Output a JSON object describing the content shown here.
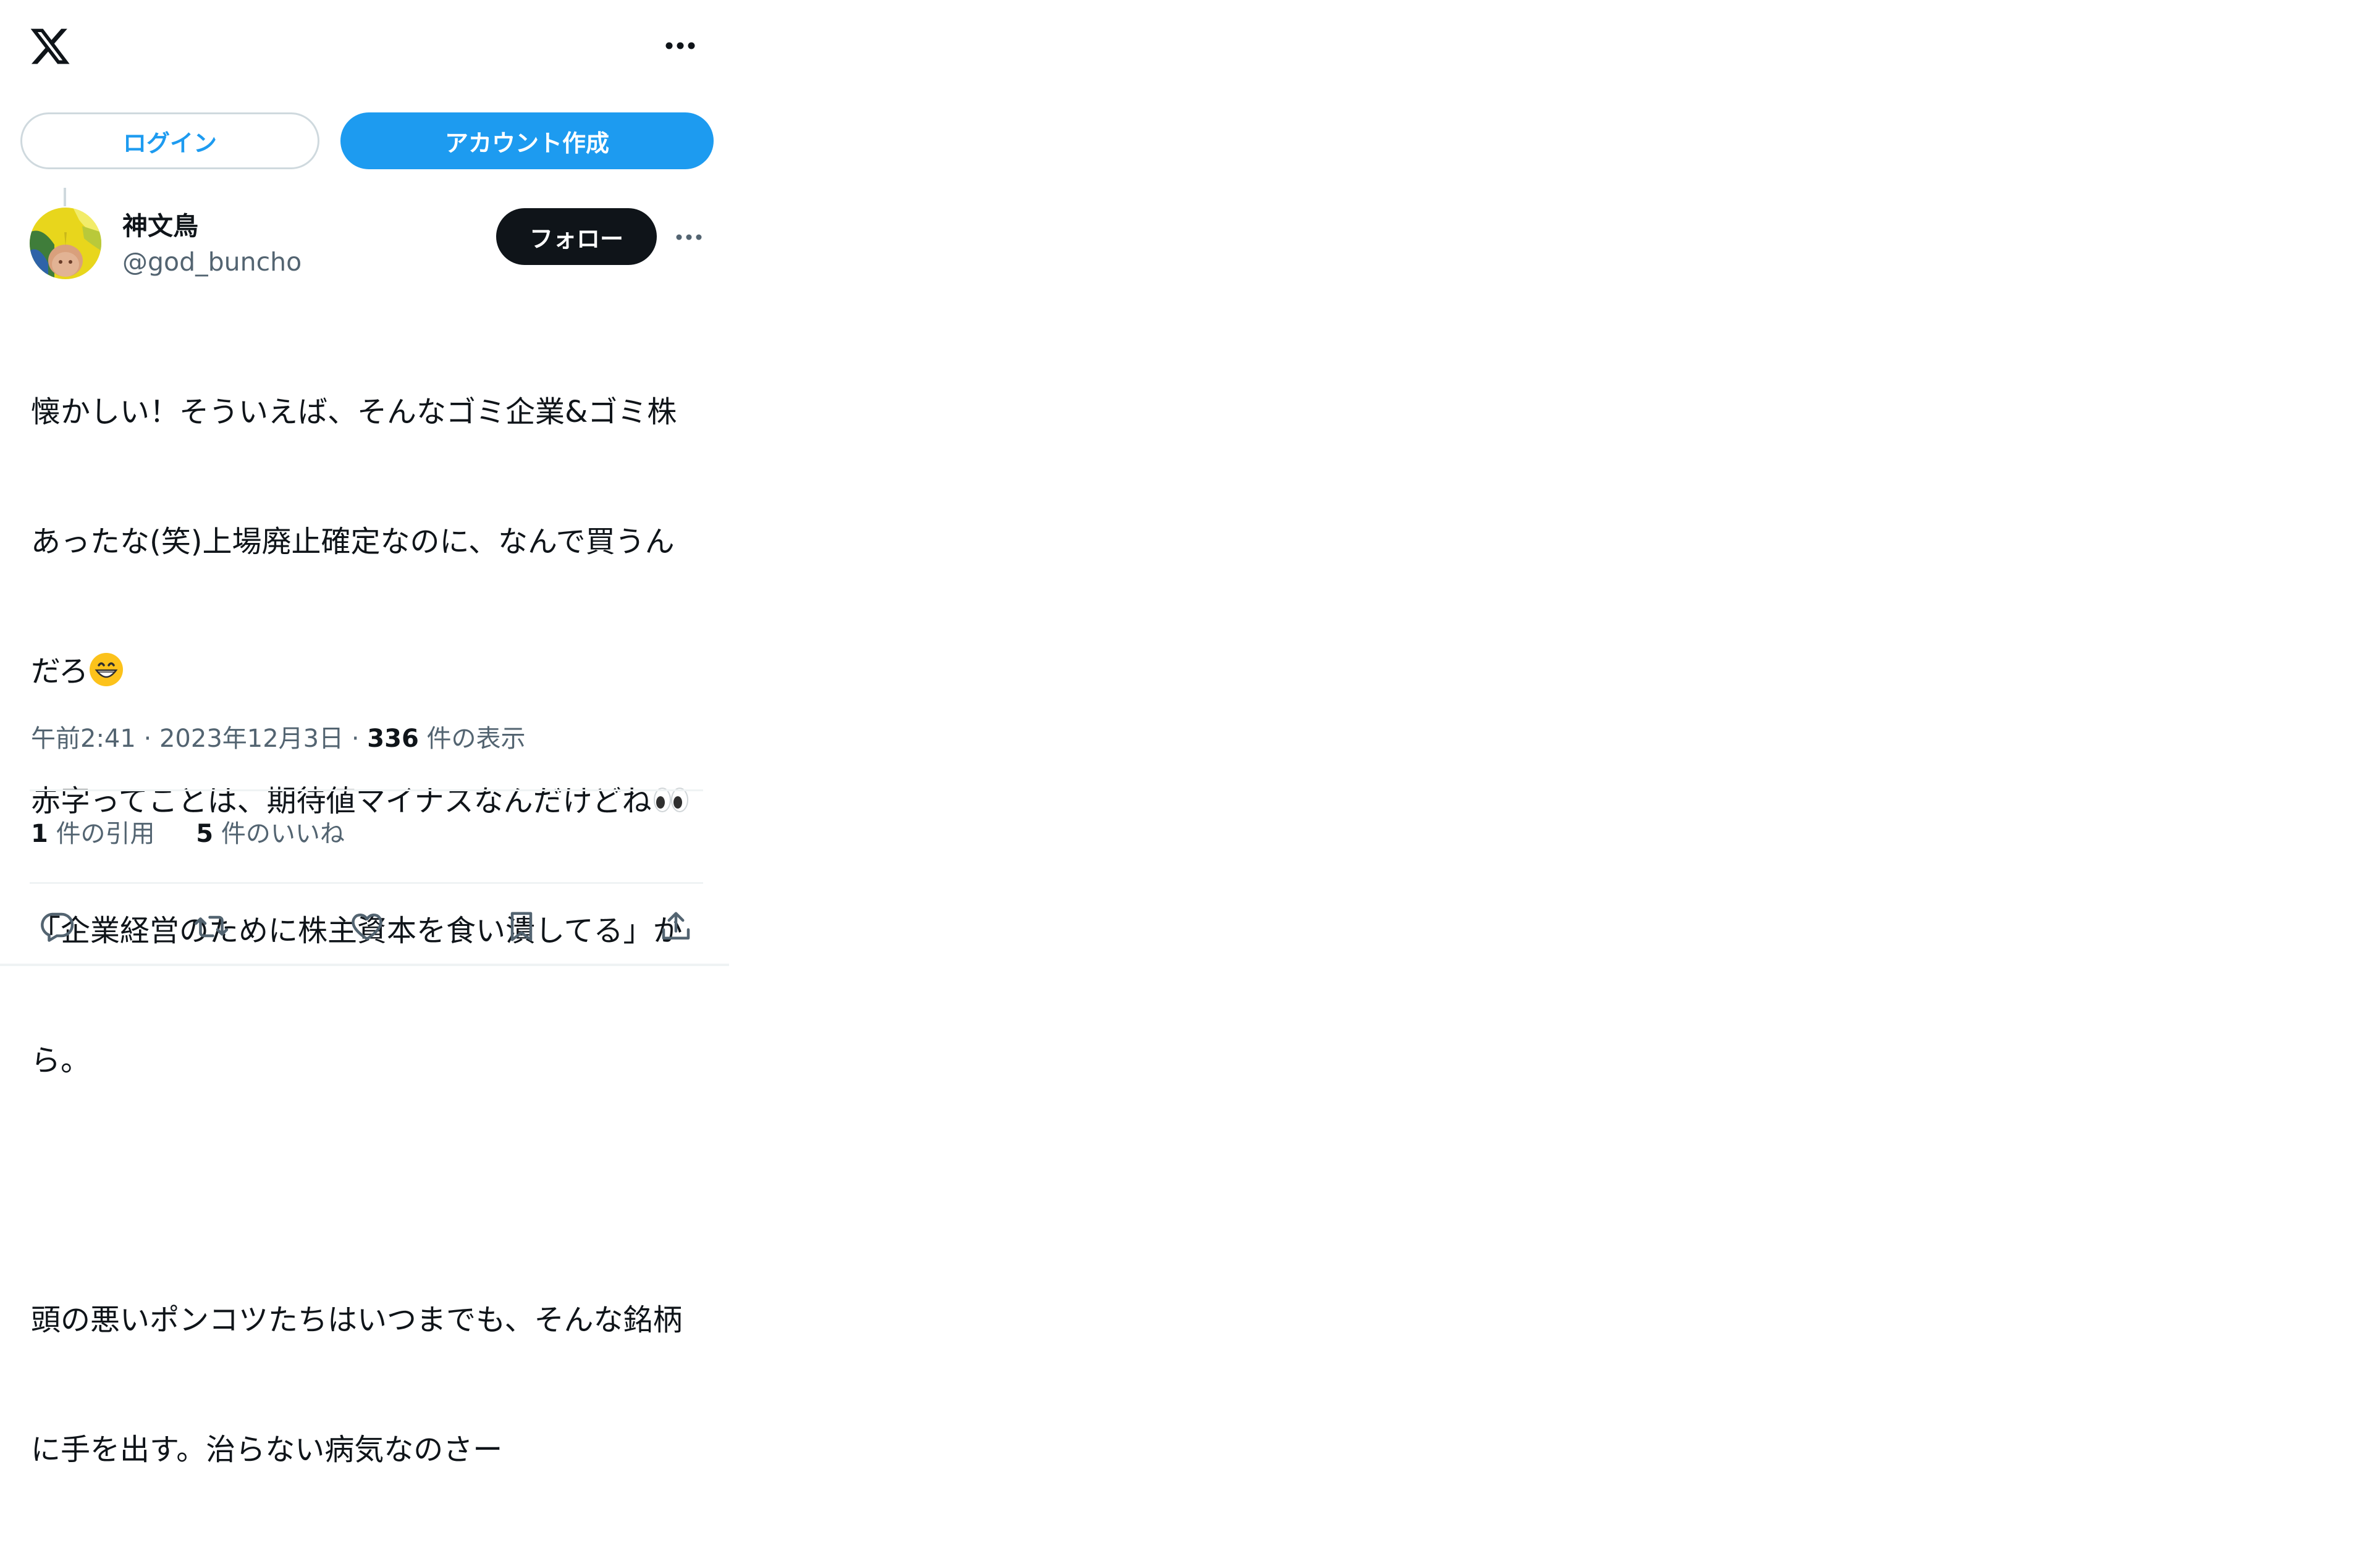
{
  "header": {
    "logo_icon": "x-logo-icon",
    "more_icon": "more-horizontal-icon"
  },
  "auth": {
    "login_label": "ログイン",
    "signup_label": "アカウント作成"
  },
  "tweet": {
    "author_name": "神文鳥",
    "author_handle": "@god_buncho",
    "follow_label": "フォロー",
    "text_line1": "懐かしい！そういえば、そんなゴミ企業&ゴミ株",
    "text_line2": "あったな(笑)上場廃止確定なのに、なんで買うん",
    "text_line3": "だろ",
    "text_line4": "赤字ってことは、期待値マイナスなんだけどね",
    "text_line5": "「企業経営のために株主資本を食い潰してる」か",
    "text_line6": "ら。",
    "text_line7": "頭の悪いポンコツたちはいつまでも、そんな銘柄",
    "text_line8": "に手を出す。治らない病気なのさー",
    "emoji_1": "grinning-face-emoji",
    "emoji_2": "eyes-emoji",
    "time": "午前2:41",
    "separator": "·",
    "date": "2023年12月3日",
    "views_count": "336",
    "views_label": "件の表示",
    "quotes_count": "1",
    "quotes_label": "件の引用",
    "likes_count": "5",
    "likes_label": "件のいいね"
  },
  "actions": {
    "reply_icon": "reply-icon",
    "retweet_icon": "retweet-icon",
    "like_icon": "heart-icon",
    "bookmark_icon": "bookmark-icon",
    "share_icon": "share-icon"
  },
  "colors": {
    "accent": "#1d9bf0",
    "text": "#0f1419",
    "secondary": "#536471",
    "border": "#cfd9de"
  }
}
